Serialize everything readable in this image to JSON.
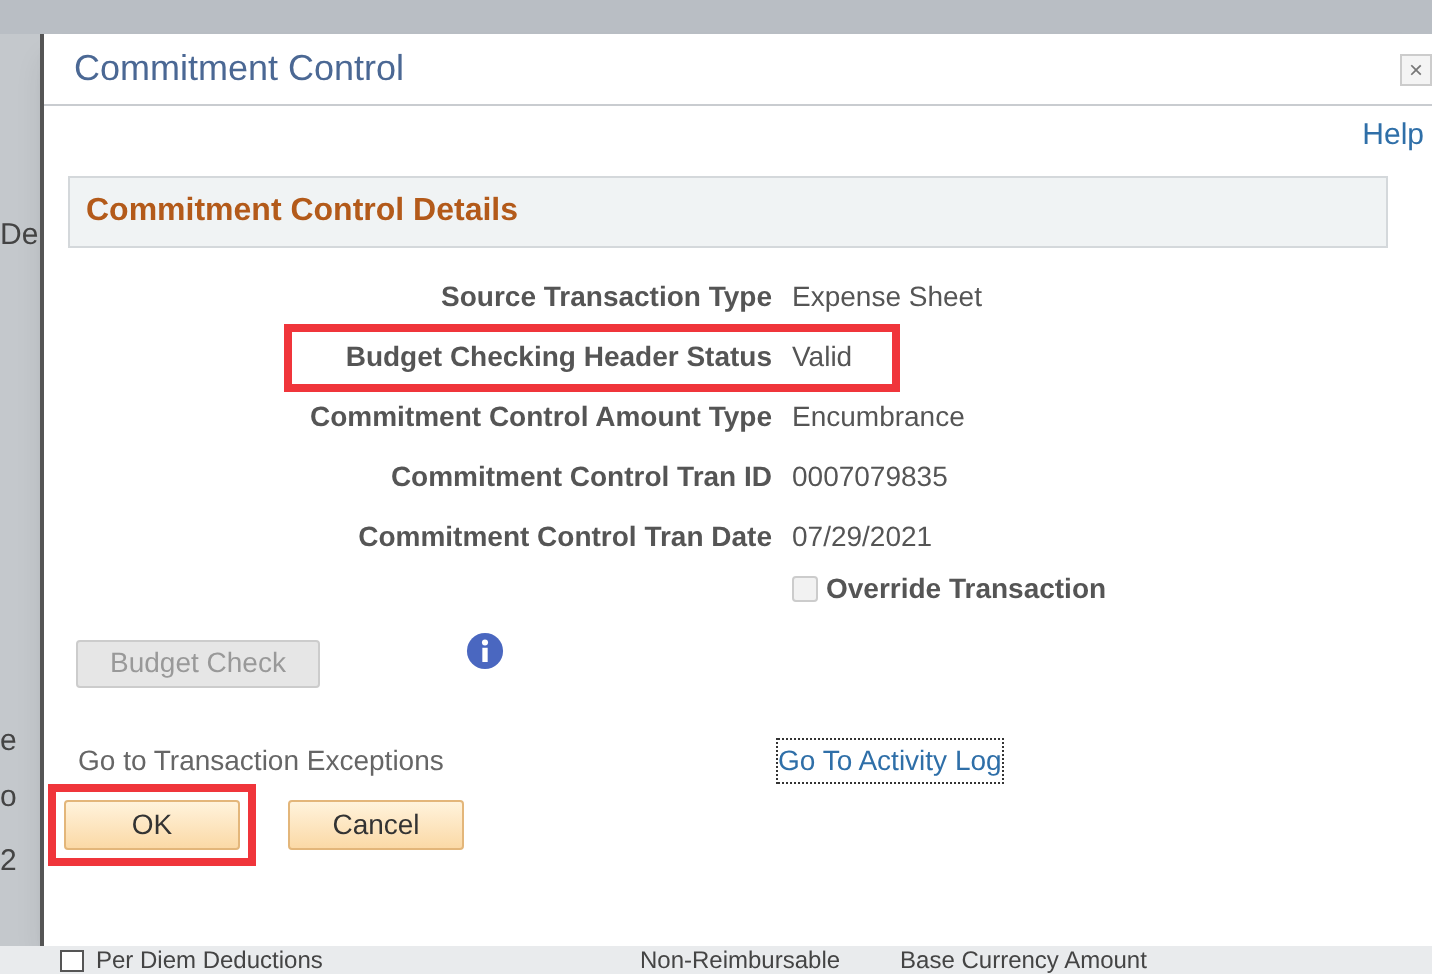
{
  "background": {
    "left_fragments": [
      "De",
      "e",
      "o",
      "2"
    ],
    "bottom_items": [
      {
        "kind": "checkbox-label",
        "text": "Per Diem Deductions",
        "checked": false
      },
      {
        "kind": "header",
        "text": "Non-Reimbursable"
      },
      {
        "kind": "header",
        "text": "Base Currency Amount"
      }
    ]
  },
  "dialog": {
    "title": "Commitment Control",
    "close": "×",
    "help": "Help",
    "section_title": "Commitment Control Details",
    "fields": [
      {
        "label": "Source Transaction Type",
        "value": "Expense Sheet",
        "highlighted": false
      },
      {
        "label": "Budget Checking Header Status",
        "value": "Valid",
        "highlighted": true
      },
      {
        "label": "Commitment Control Amount Type",
        "value": "Encumbrance",
        "highlighted": false
      },
      {
        "label": "Commitment Control Tran ID",
        "value": "0007079835",
        "highlighted": false
      },
      {
        "label": "Commitment Control Tran Date",
        "value": "07/29/2021",
        "highlighted": false
      }
    ],
    "override": {
      "label": "Override Transaction",
      "checked": false,
      "disabled": true
    },
    "budget_check": {
      "label": "Budget Check",
      "disabled": true
    },
    "links": [
      {
        "label": "Go to Transaction Exceptions",
        "disabled": true,
        "focused": false
      },
      {
        "label": "Go To Activity Log",
        "disabled": false,
        "focused": true
      }
    ],
    "buttons": [
      {
        "label": "OK",
        "highlighted": true
      },
      {
        "label": "Cancel",
        "highlighted": false
      }
    ]
  }
}
